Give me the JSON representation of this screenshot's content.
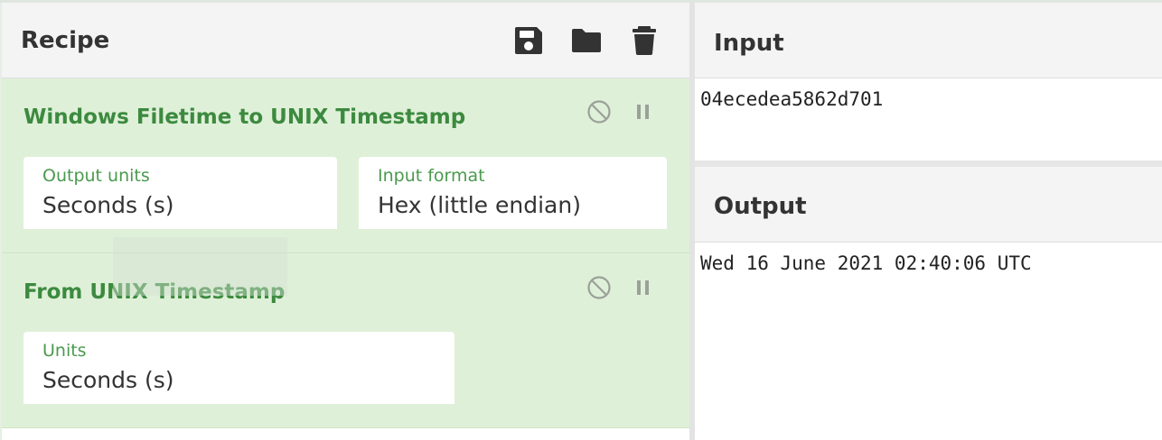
{
  "recipe": {
    "title": "Recipe",
    "icons": [
      "save-icon",
      "folder-icon",
      "trash-icon"
    ],
    "operations": [
      {
        "title": "Windows Filetime to UNIX Timestamp",
        "fields": [
          {
            "label": "Output units",
            "value": "Seconds (s)"
          },
          {
            "label": "Input format",
            "value": "Hex (little endian)"
          }
        ]
      },
      {
        "title": "From UNIX Timestamp",
        "fields": [
          {
            "label": "Units",
            "value": "Seconds (s)"
          }
        ]
      }
    ]
  },
  "input": {
    "title": "Input",
    "value": "04ecedea5862d701"
  },
  "output": {
    "title": "Output",
    "value": "Wed 16 June 2021 02:40:06 UTC"
  },
  "colors": {
    "op_background": "#dff0d8",
    "op_title": "#3c8a3f",
    "field_label": "#4a9a4e"
  }
}
